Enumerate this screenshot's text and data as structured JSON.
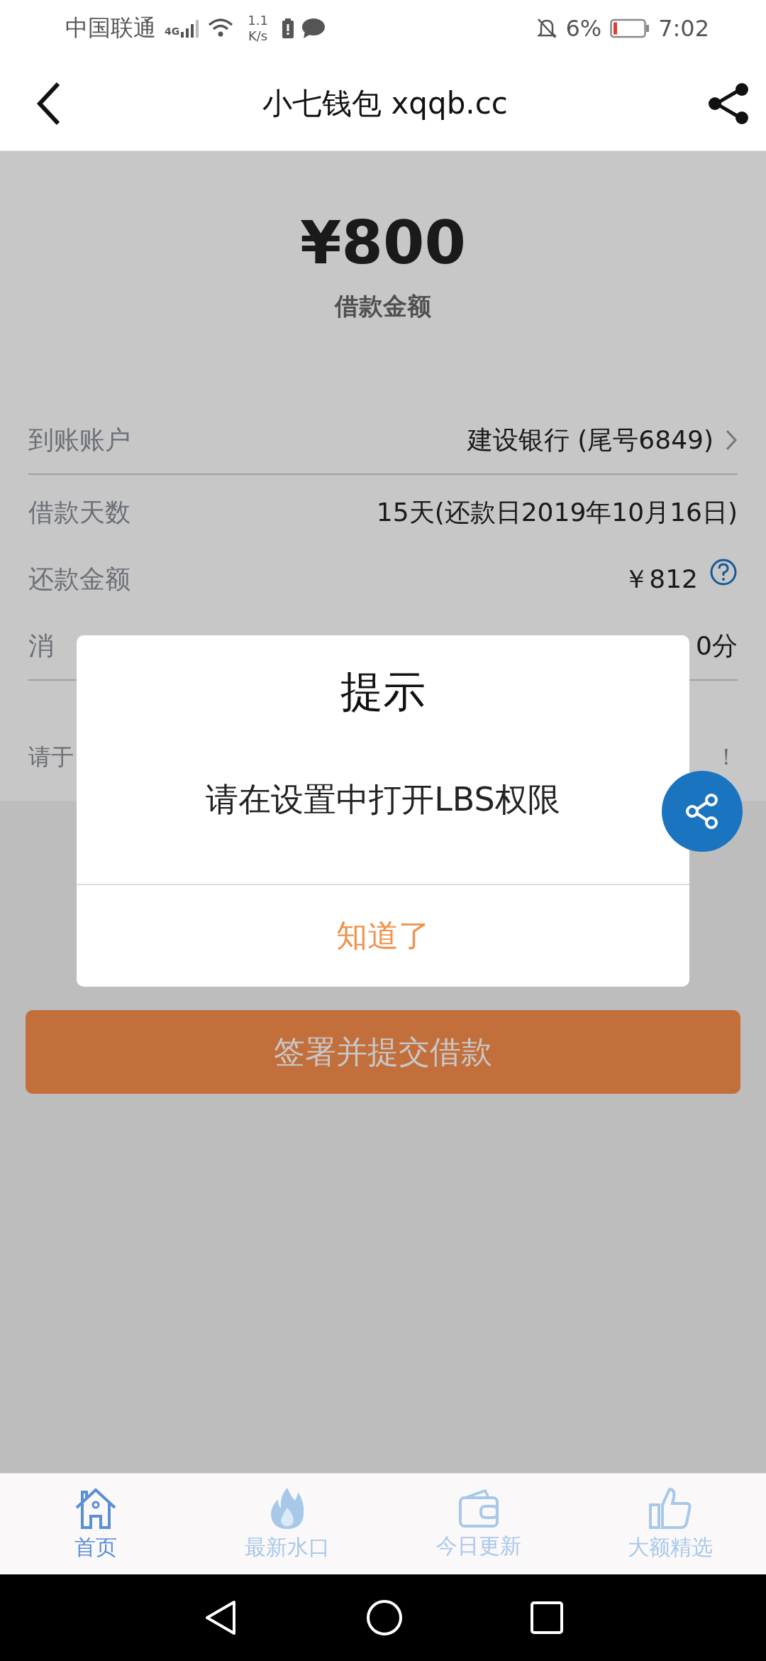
{
  "status_bar": {
    "carrier": "中国联通",
    "network": "4G",
    "speed_value": "1.1",
    "speed_unit": "K/s",
    "battery": "6%",
    "time": "7:02"
  },
  "header": {
    "title": "小七钱包 xqqb.cc"
  },
  "loan": {
    "amount": "¥800",
    "label": "借款金额"
  },
  "rows": [
    {
      "kind": "link",
      "label": "到账账户",
      "value": "建设银行 (尾号6849)",
      "divider": true
    },
    {
      "kind": "plain",
      "label": "借款天数",
      "value": "15天(还款日2019年10月16日)",
      "divider": false
    },
    {
      "kind": "info",
      "label": "还款金额",
      "value": "￥812",
      "divider": false
    },
    {
      "kind": "plain",
      "label": "消",
      "value": "0分",
      "divider": true
    }
  ],
  "notice": {
    "left": "请于",
    "right": "！"
  },
  "submit_button": "签署并提交借款",
  "dialog": {
    "title": "提示",
    "message": "请在设置中打开LBS权限",
    "button": "知道了"
  },
  "nav": [
    {
      "kind": "home",
      "label": "首页",
      "selected": true
    },
    {
      "kind": "fire",
      "label": "最新水口",
      "selected": false
    },
    {
      "kind": "wallet",
      "label": "今日更新",
      "selected": false
    },
    {
      "kind": "thumb",
      "label": "大额精选",
      "selected": false
    }
  ]
}
